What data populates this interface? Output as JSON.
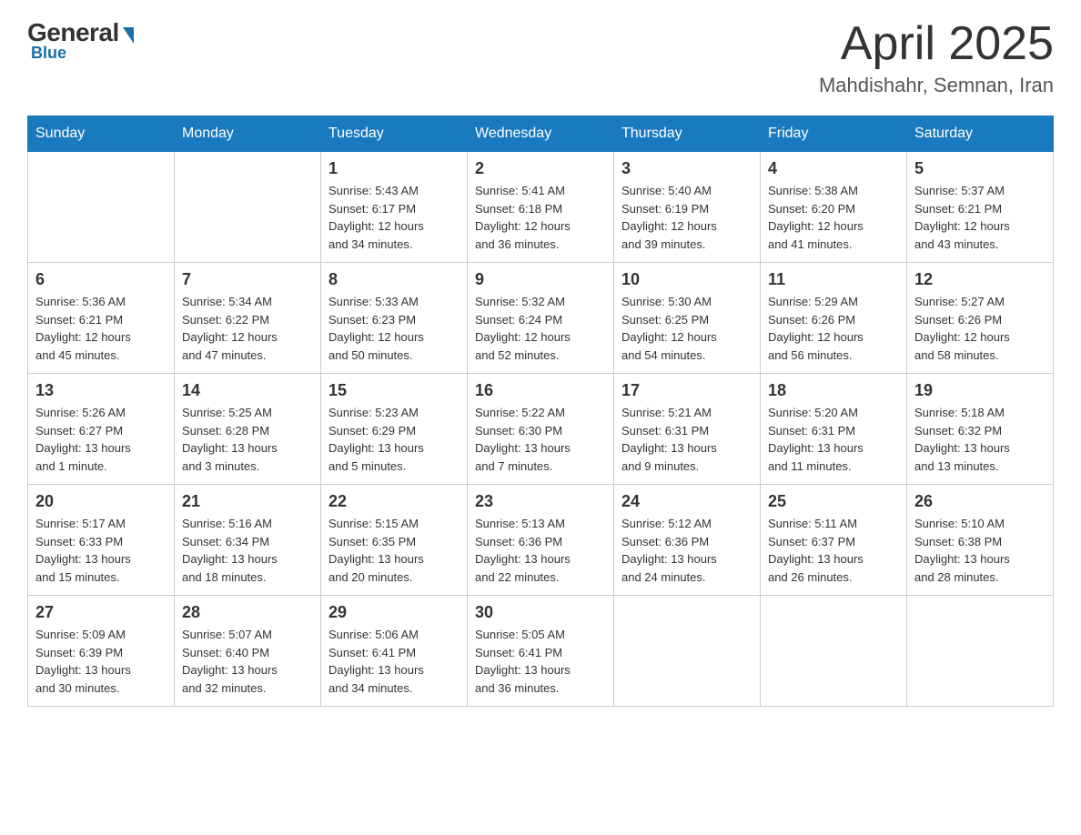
{
  "logo": {
    "general_text": "General",
    "blue_text": "Blue"
  },
  "header": {
    "month": "April 2025",
    "location": "Mahdishahr, Semnan, Iran"
  },
  "weekdays": [
    "Sunday",
    "Monday",
    "Tuesday",
    "Wednesday",
    "Thursday",
    "Friday",
    "Saturday"
  ],
  "weeks": [
    [
      {
        "day": "",
        "info": ""
      },
      {
        "day": "",
        "info": ""
      },
      {
        "day": "1",
        "info": "Sunrise: 5:43 AM\nSunset: 6:17 PM\nDaylight: 12 hours\nand 34 minutes."
      },
      {
        "day": "2",
        "info": "Sunrise: 5:41 AM\nSunset: 6:18 PM\nDaylight: 12 hours\nand 36 minutes."
      },
      {
        "day": "3",
        "info": "Sunrise: 5:40 AM\nSunset: 6:19 PM\nDaylight: 12 hours\nand 39 minutes."
      },
      {
        "day": "4",
        "info": "Sunrise: 5:38 AM\nSunset: 6:20 PM\nDaylight: 12 hours\nand 41 minutes."
      },
      {
        "day": "5",
        "info": "Sunrise: 5:37 AM\nSunset: 6:21 PM\nDaylight: 12 hours\nand 43 minutes."
      }
    ],
    [
      {
        "day": "6",
        "info": "Sunrise: 5:36 AM\nSunset: 6:21 PM\nDaylight: 12 hours\nand 45 minutes."
      },
      {
        "day": "7",
        "info": "Sunrise: 5:34 AM\nSunset: 6:22 PM\nDaylight: 12 hours\nand 47 minutes."
      },
      {
        "day": "8",
        "info": "Sunrise: 5:33 AM\nSunset: 6:23 PM\nDaylight: 12 hours\nand 50 minutes."
      },
      {
        "day": "9",
        "info": "Sunrise: 5:32 AM\nSunset: 6:24 PM\nDaylight: 12 hours\nand 52 minutes."
      },
      {
        "day": "10",
        "info": "Sunrise: 5:30 AM\nSunset: 6:25 PM\nDaylight: 12 hours\nand 54 minutes."
      },
      {
        "day": "11",
        "info": "Sunrise: 5:29 AM\nSunset: 6:26 PM\nDaylight: 12 hours\nand 56 minutes."
      },
      {
        "day": "12",
        "info": "Sunrise: 5:27 AM\nSunset: 6:26 PM\nDaylight: 12 hours\nand 58 minutes."
      }
    ],
    [
      {
        "day": "13",
        "info": "Sunrise: 5:26 AM\nSunset: 6:27 PM\nDaylight: 13 hours\nand 1 minute."
      },
      {
        "day": "14",
        "info": "Sunrise: 5:25 AM\nSunset: 6:28 PM\nDaylight: 13 hours\nand 3 minutes."
      },
      {
        "day": "15",
        "info": "Sunrise: 5:23 AM\nSunset: 6:29 PM\nDaylight: 13 hours\nand 5 minutes."
      },
      {
        "day": "16",
        "info": "Sunrise: 5:22 AM\nSunset: 6:30 PM\nDaylight: 13 hours\nand 7 minutes."
      },
      {
        "day": "17",
        "info": "Sunrise: 5:21 AM\nSunset: 6:31 PM\nDaylight: 13 hours\nand 9 minutes."
      },
      {
        "day": "18",
        "info": "Sunrise: 5:20 AM\nSunset: 6:31 PM\nDaylight: 13 hours\nand 11 minutes."
      },
      {
        "day": "19",
        "info": "Sunrise: 5:18 AM\nSunset: 6:32 PM\nDaylight: 13 hours\nand 13 minutes."
      }
    ],
    [
      {
        "day": "20",
        "info": "Sunrise: 5:17 AM\nSunset: 6:33 PM\nDaylight: 13 hours\nand 15 minutes."
      },
      {
        "day": "21",
        "info": "Sunrise: 5:16 AM\nSunset: 6:34 PM\nDaylight: 13 hours\nand 18 minutes."
      },
      {
        "day": "22",
        "info": "Sunrise: 5:15 AM\nSunset: 6:35 PM\nDaylight: 13 hours\nand 20 minutes."
      },
      {
        "day": "23",
        "info": "Sunrise: 5:13 AM\nSunset: 6:36 PM\nDaylight: 13 hours\nand 22 minutes."
      },
      {
        "day": "24",
        "info": "Sunrise: 5:12 AM\nSunset: 6:36 PM\nDaylight: 13 hours\nand 24 minutes."
      },
      {
        "day": "25",
        "info": "Sunrise: 5:11 AM\nSunset: 6:37 PM\nDaylight: 13 hours\nand 26 minutes."
      },
      {
        "day": "26",
        "info": "Sunrise: 5:10 AM\nSunset: 6:38 PM\nDaylight: 13 hours\nand 28 minutes."
      }
    ],
    [
      {
        "day": "27",
        "info": "Sunrise: 5:09 AM\nSunset: 6:39 PM\nDaylight: 13 hours\nand 30 minutes."
      },
      {
        "day": "28",
        "info": "Sunrise: 5:07 AM\nSunset: 6:40 PM\nDaylight: 13 hours\nand 32 minutes."
      },
      {
        "day": "29",
        "info": "Sunrise: 5:06 AM\nSunset: 6:41 PM\nDaylight: 13 hours\nand 34 minutes."
      },
      {
        "day": "30",
        "info": "Sunrise: 5:05 AM\nSunset: 6:41 PM\nDaylight: 13 hours\nand 36 minutes."
      },
      {
        "day": "",
        "info": ""
      },
      {
        "day": "",
        "info": ""
      },
      {
        "day": "",
        "info": ""
      }
    ]
  ]
}
